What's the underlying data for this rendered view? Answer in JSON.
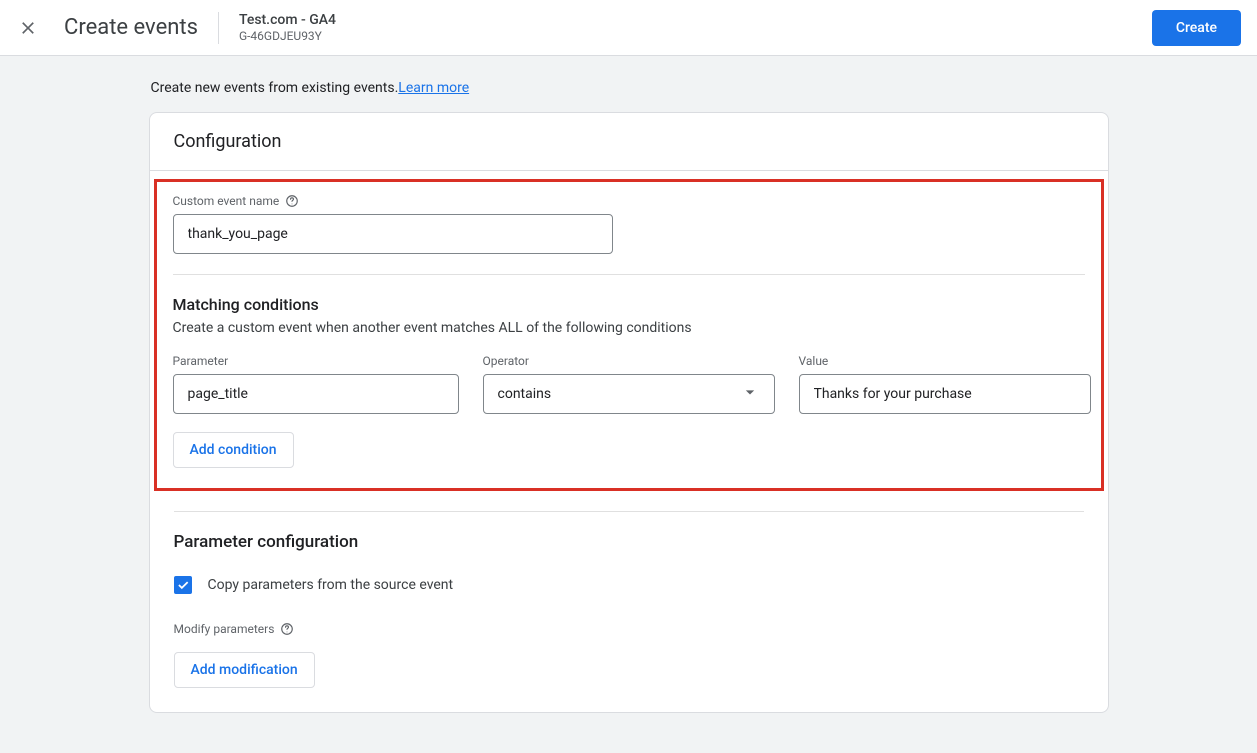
{
  "topbar": {
    "title": "Create events",
    "property_name": "Test.com - GA4",
    "property_id": "G-46GDJEU93Y",
    "create_label": "Create"
  },
  "intro": {
    "text": "Create new events from existing events.",
    "link_label": "Learn more"
  },
  "config": {
    "header": "Configuration",
    "custom_name_label": "Custom event name",
    "custom_name_value": "thank_you_page",
    "matching": {
      "title": "Matching conditions",
      "desc": "Create a custom event when another event matches ALL of the following conditions",
      "param_label": "Parameter",
      "param_value": "page_title",
      "operator_label": "Operator",
      "operator_value": "contains",
      "value_label": "Value",
      "value_value": "Thanks for your purchase",
      "add_condition_label": "Add condition"
    },
    "param_config": {
      "title": "Parameter configuration",
      "copy_label": "Copy parameters from the source event",
      "modify_label": "Modify parameters",
      "add_modification_label": "Add modification"
    }
  }
}
